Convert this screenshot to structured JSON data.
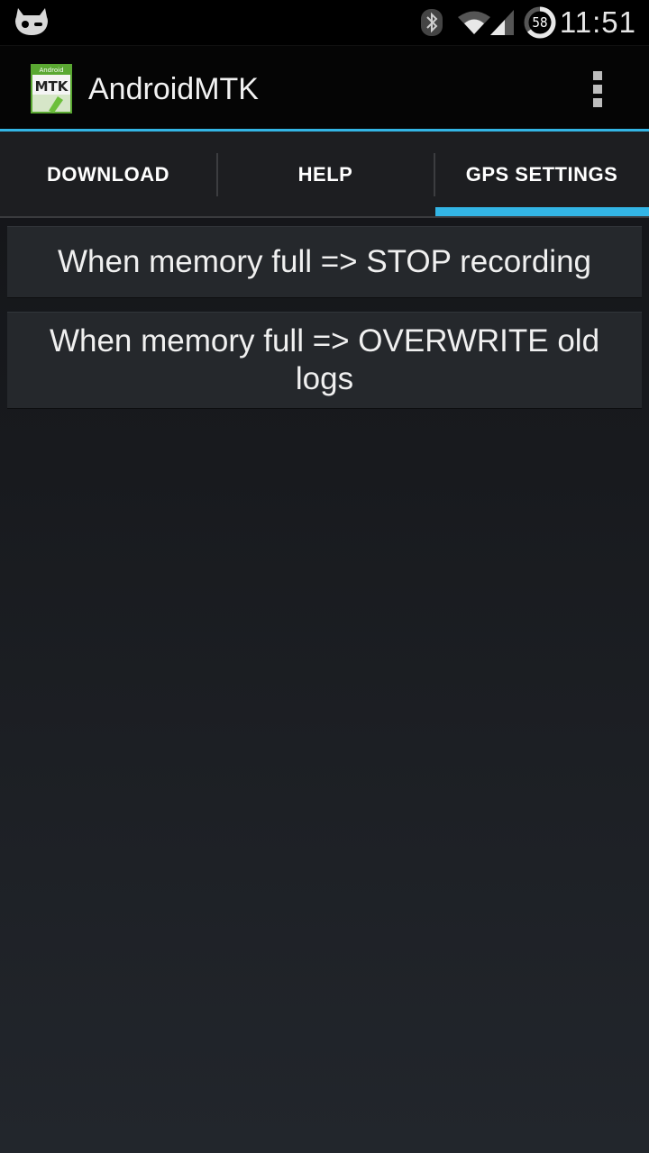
{
  "status_bar": {
    "time": "11:51",
    "battery_level": "58",
    "icons": [
      "cyanogen-icon",
      "bluetooth-icon",
      "wifi-icon",
      "signal-icon",
      "battery-icon"
    ]
  },
  "action_bar": {
    "app_icon_text": "MTK",
    "app_icon_small_text": "Android",
    "title": "AndroidMTK",
    "overflow_icon": "overflow-menu-icon"
  },
  "tabs": [
    {
      "label": "DOWNLOAD",
      "selected": false
    },
    {
      "label": "HELP",
      "selected": false
    },
    {
      "label": "GPS SETTINGS",
      "selected": true
    }
  ],
  "main": {
    "buttons": [
      {
        "label": "When memory full => STOP recording"
      },
      {
        "label": "When memory full => OVERWRITE old logs"
      }
    ]
  },
  "colors": {
    "accent": "#33b5e5",
    "background": "#1a1c20",
    "button": "#25282c"
  }
}
